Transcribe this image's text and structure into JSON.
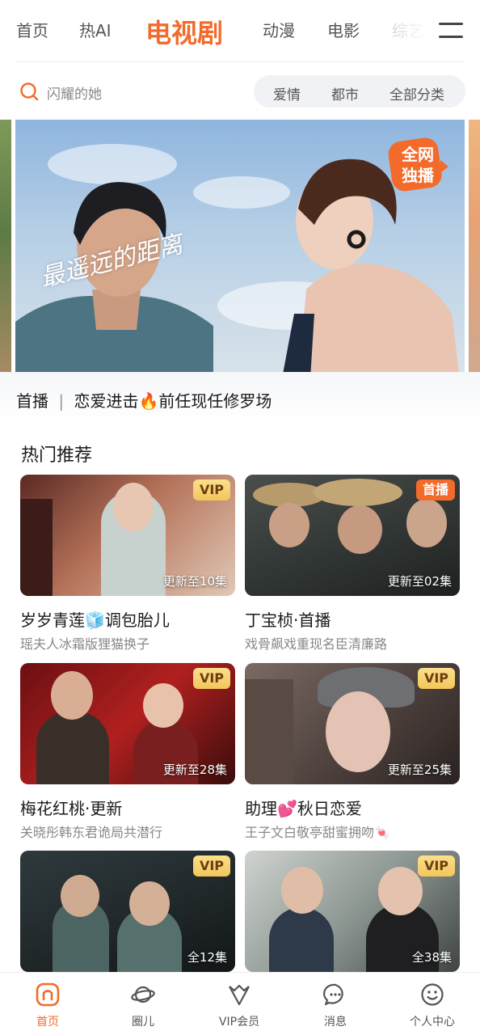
{
  "top_nav": {
    "tabs": [
      {
        "label": "首页"
      },
      {
        "label": "热AI"
      },
      {
        "label": "电视剧"
      },
      {
        "label": "动漫"
      },
      {
        "label": "电影"
      },
      {
        "label": "综艺"
      }
    ],
    "active_tab": "电视剧",
    "menu_icon": "hamburger-menu-icon"
  },
  "search": {
    "placeholder": "闪耀的她",
    "icon": "search-icon"
  },
  "categories": [
    "爱情",
    "都市",
    "全部分类"
  ],
  "banner": {
    "title_art": "最遥远的距离",
    "badge": "全网独播",
    "caption_prefix": "首播",
    "caption_text": "恋爱进击🔥前任现任修罗场"
  },
  "section": {
    "title": "热门推荐"
  },
  "cards": [
    {
      "badge": "VIP",
      "episode": "更新至10集",
      "title": "岁岁青莲🧊调包胎儿",
      "subtitle": "瑶夫人冰霜版狸猫换子"
    },
    {
      "badge": "首播",
      "episode": "更新至02集",
      "title": "丁宝桢·首播",
      "subtitle": "戏骨飙戏重现名臣清廉路"
    },
    {
      "badge": "VIP",
      "episode": "更新至28集",
      "title": "梅花红桃·更新",
      "subtitle": "关晓彤韩东君诡局共潜行"
    },
    {
      "badge": "VIP",
      "episode": "更新至25集",
      "title": "助理💕秋日恋爱",
      "subtitle": "王子文白敬亭甜蜜拥吻🍬"
    },
    {
      "badge": "VIP",
      "episode": "全12集",
      "title": "",
      "subtitle": ""
    },
    {
      "badge": "VIP",
      "episode": "全38集",
      "title": "",
      "subtitle": ""
    }
  ],
  "bottom_nav": [
    {
      "label": "首页",
      "icon": "home-icon",
      "active": true
    },
    {
      "label": "圈儿",
      "icon": "planet-icon",
      "active": false
    },
    {
      "label": "VIP会员",
      "icon": "vip-crown-icon",
      "active": false
    },
    {
      "label": "消息",
      "icon": "message-icon",
      "active": false
    },
    {
      "label": "个人中心",
      "icon": "smiley-face-icon",
      "active": false
    }
  ],
  "colors": {
    "accent": "#f36a2b",
    "vip_gold": "#f3c659",
    "text_primary": "#1a1a1a",
    "text_secondary": "#888888"
  }
}
